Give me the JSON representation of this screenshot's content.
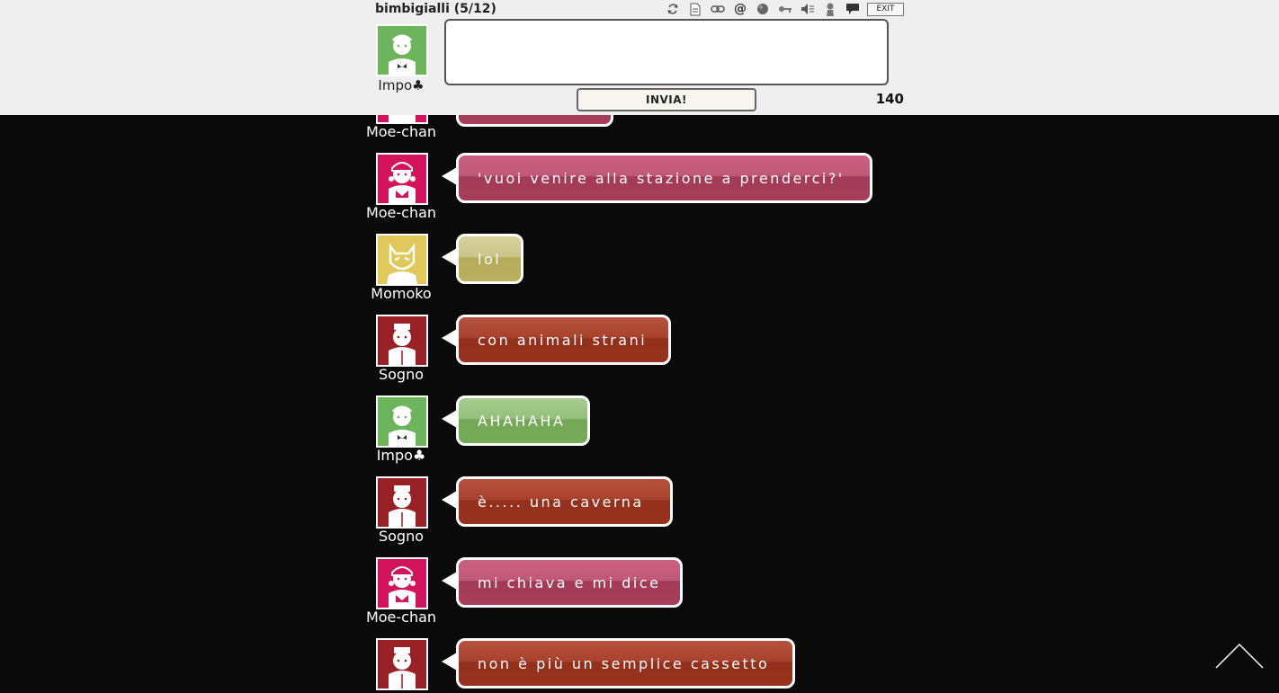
{
  "header": {
    "room_title": "bimbigialli (5/12)",
    "toolbar_icons": [
      "refresh-icon",
      "document-icon",
      "link-icon",
      "at-icon",
      "ball-icon",
      "key-icon",
      "sound-off-icon",
      "user-silhouette-icon",
      "speech-bubble-icon"
    ],
    "exit_label": "EXIT"
  },
  "composer": {
    "username": "Impo♣",
    "message_value": "",
    "send_label": "INVIA!",
    "char_counter": "140"
  },
  "messages": [
    {
      "name": "Moe-chan",
      "text": "",
      "color": "#c05878"
    },
    {
      "name": "Moe-chan",
      "text": "'vuoi venire alla stazione a prenderci?'",
      "color": "#c05878"
    },
    {
      "name": "Momoko",
      "text": "lol",
      "color": "#ccc489"
    },
    {
      "name": "Sogno",
      "text": "con animali strani",
      "color": "#a9422d"
    },
    {
      "name": "Impo♣",
      "text": "AHAHAHA",
      "color": "#95c07c"
    },
    {
      "name": "Sogno",
      "text": "è..... una caverna",
      "color": "#a9422d"
    },
    {
      "name": "Moe-chan",
      "text": "mi chiava e mi dice",
      "color": "#c05878"
    },
    {
      "name": "",
      "text": "non è più un semplice cassetto",
      "color": "#a9422d"
    }
  ],
  "colors": {
    "header_bg": "#efefef",
    "chat_bg": "#0a0a0a",
    "moe_chan": "#d4145a",
    "sogno": "#9a2028",
    "impo": "#6db55a",
    "momoko": "#e0c95a"
  }
}
